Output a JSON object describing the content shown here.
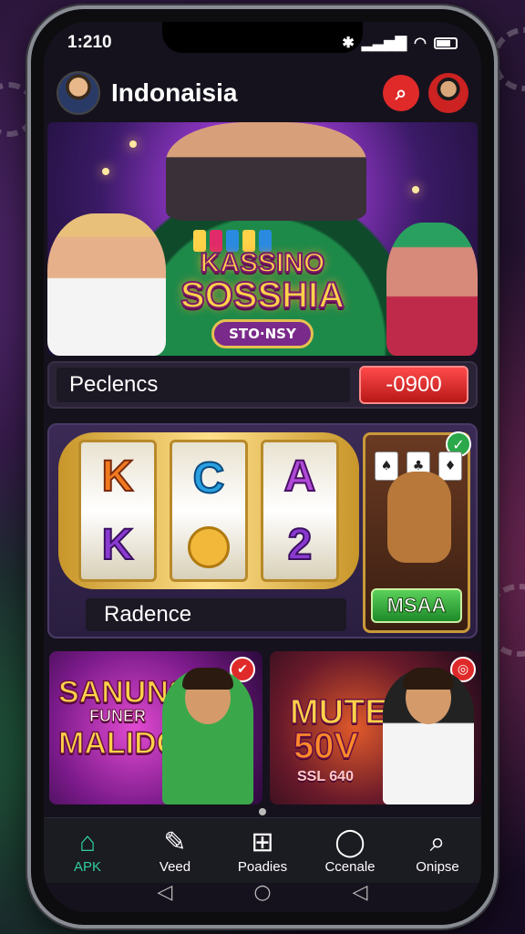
{
  "status": {
    "time": "1:210"
  },
  "header": {
    "title": "Indonaisia"
  },
  "hero": {
    "logo_line1": "KASSINO",
    "logo_line2": "SOSSHIA",
    "pill": "STO·NSY"
  },
  "balance": {
    "label": "Peclencs",
    "amount": "-0900"
  },
  "slots": {
    "reel1": [
      "K",
      "K"
    ],
    "reel2": [
      "C"
    ],
    "reel3": [
      "A",
      "2"
    ],
    "label": "Radence",
    "side_button": "MSAA"
  },
  "promos": [
    {
      "line1": "SANUNS",
      "line2": "FUNER",
      "line3": "MALIDGE"
    },
    {
      "line1": "MUTE",
      "line2": "50V",
      "line3": "SSL 640"
    }
  ],
  "nav": {
    "items": [
      {
        "label": "APK",
        "icon": "home-icon"
      },
      {
        "label": "Veed",
        "icon": "edit-icon"
      },
      {
        "label": "Poadies",
        "icon": "plus-square-icon"
      },
      {
        "label": "Ccenale",
        "icon": "chat-icon"
      },
      {
        "label": "Onipse",
        "icon": "search-icon"
      }
    ]
  },
  "colors": {
    "accent": "#2ed09a",
    "danger": "#e02a2a",
    "gold": "#ffd24a"
  }
}
